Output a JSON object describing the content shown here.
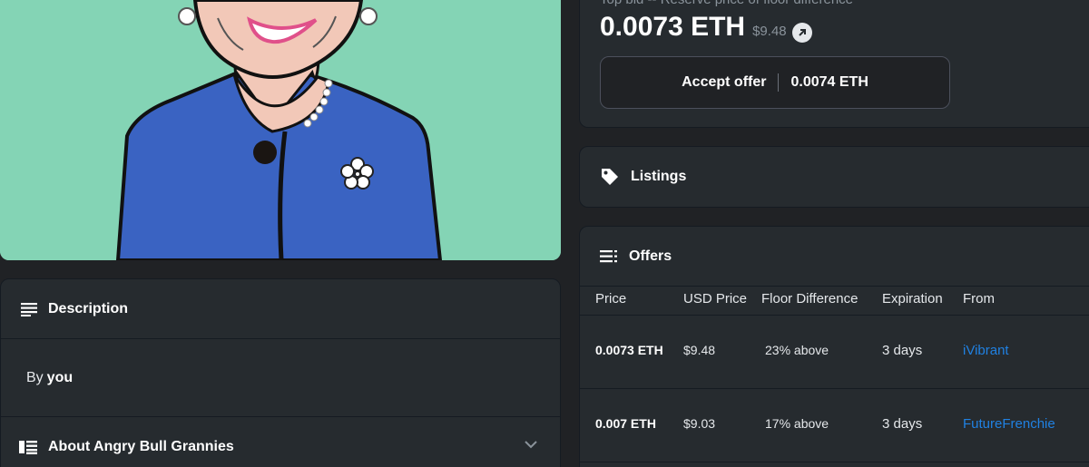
{
  "price_box": {
    "label": "Top bid -- Reserve price of floor difference",
    "price": "0.0073 ETH",
    "usd": "$9.48",
    "accept_label": "Accept offer",
    "accept_price": "0.0074 ETH"
  },
  "listings": {
    "title": "Listings"
  },
  "offers": {
    "title": "Offers",
    "columns": [
      "Price",
      "USD Price",
      "Floor Difference",
      "Expiration",
      "From"
    ],
    "rows": [
      {
        "price": "0.0073 ETH",
        "usd": "$9.48",
        "floor": "23% above",
        "expiration": "3 days",
        "from": "iVibrant"
      },
      {
        "price": "0.007 ETH",
        "usd": "$9.03",
        "floor": "17% above",
        "expiration": "3 days",
        "from": "FutureFrenchie"
      }
    ]
  },
  "description": {
    "title": "Description",
    "by_prefix": "By",
    "by_user": "you"
  },
  "about": {
    "title": "About Angry Bull Grannies"
  },
  "colors": {
    "accent": "#2081e2",
    "art_bg": "#84d4b5",
    "jacket": "#3a63c2"
  },
  "icons": [
    "sort-lines-icon",
    "tag-icon",
    "list-icon",
    "description-icon",
    "about-icon",
    "chevron-down-icon",
    "arrow-up-right-icon"
  ]
}
